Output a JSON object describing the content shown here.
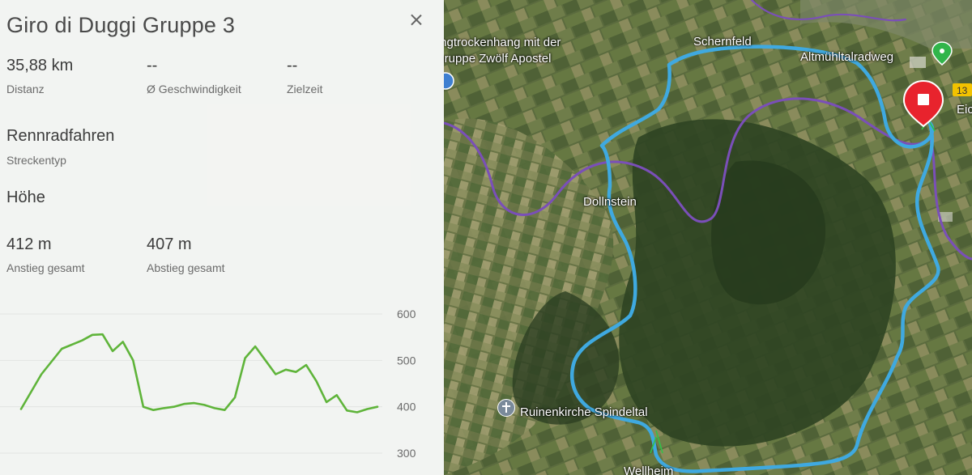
{
  "route": {
    "title": "Giro di Duggi Gruppe 3",
    "distance_value": "35,88 km",
    "distance_label": "Distanz",
    "speed_value": "--",
    "speed_label": "Ø Geschwindigkeit",
    "time_value": "--",
    "time_label": "Zielzeit",
    "type_value": "Rennradfahren",
    "type_label": "Streckentyp",
    "elevation_heading": "Höhe",
    "ascent_value": "412 m",
    "ascent_label": "Anstieg gesamt",
    "descent_value": "407 m",
    "descent_label": "Abstieg gesamt"
  },
  "chart_data": {
    "type": "line",
    "ylim": [
      300,
      600
    ],
    "yticks": [
      "600",
      "500",
      "400",
      "300"
    ],
    "tick_values": [
      600,
      500,
      400,
      300
    ],
    "x": [
      0,
      2,
      4,
      6,
      7,
      8,
      9,
      10,
      11,
      12,
      13,
      14,
      15,
      16,
      17,
      18,
      19,
      20,
      21,
      22,
      23,
      24,
      25,
      26,
      27,
      28,
      29,
      30,
      31,
      32,
      33,
      34,
      35
    ],
    "values": [
      395,
      470,
      525,
      543,
      555,
      556,
      520,
      540,
      500,
      400,
      393,
      397,
      400,
      406,
      408,
      404,
      397,
      393,
      420,
      505,
      530,
      500,
      470,
      480,
      475,
      490,
      455,
      410,
      425,
      392,
      388,
      395,
      400
    ],
    "color": "#5fb43a"
  },
  "map": {
    "labels": {
      "trockenhang": "Hangtrockenhang mit der",
      "felsgruppe": "Felsgruppe Zwölf Apostel",
      "schernfeld": "Schernfeld",
      "altmuehl": "Altmühltalradweg",
      "dollnstein": "Dollnstein",
      "ruinenkirche": "Ruinenkirche Spindeltal",
      "eich": "Eic",
      "wellheim": "Wellheim",
      "road_badge": "13"
    },
    "route_color": "#3fa9e0",
    "river_color": "#7a4fb8",
    "marker_color": "#e8232d"
  }
}
